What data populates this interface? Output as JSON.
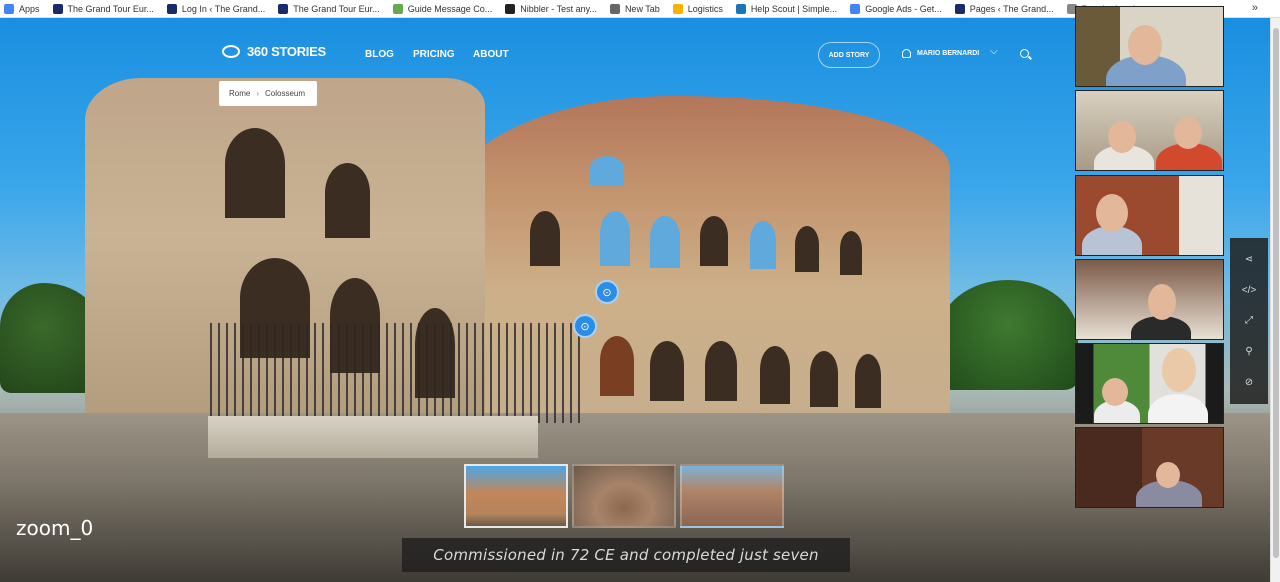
{
  "bookmarks": {
    "items": [
      {
        "label": "Apps",
        "color": "#4285f4"
      },
      {
        "label": "The Grand Tour Eur...",
        "color": "#1a2b6b"
      },
      {
        "label": "Log In ‹ The Grand...",
        "color": "#1a2b6b"
      },
      {
        "label": "The Grand Tour Eur...",
        "color": "#1a2b6b"
      },
      {
        "label": "Guide Message Co...",
        "color": "#6aa84f"
      },
      {
        "label": "Nibbler - Test any...",
        "color": "#222222"
      },
      {
        "label": "New Tab",
        "color": "#666666"
      },
      {
        "label": "Logistics",
        "color": "#f4b400"
      },
      {
        "label": "Help Scout | Simple...",
        "color": "#1f73b7"
      },
      {
        "label": "Google Ads - Get...",
        "color": "#4285f4"
      },
      {
        "label": "Pages ‹ The Grand...",
        "color": "#1a2b6b"
      },
      {
        "label": "Popular Landscape...",
        "color": "#888888"
      }
    ],
    "more": "»"
  },
  "site": {
    "logo": "360 STORIES",
    "nav": [
      "BLOG",
      "PRICING",
      "ABOUT"
    ],
    "add_story": "ADD STORY",
    "user": "MARIO BERNARDI",
    "chevron": "⌵"
  },
  "breadcrumb": {
    "root": "Rome",
    "sep": "›",
    "current": "Colosseum"
  },
  "caption": "Commissioned in 72 CE and completed just seven",
  "zoom_label": "zoom_0",
  "tools": [
    "⋖",
    "</>",
    "⤢",
    "⚲",
    "⊘"
  ],
  "hotspot_glyph": "⊙"
}
